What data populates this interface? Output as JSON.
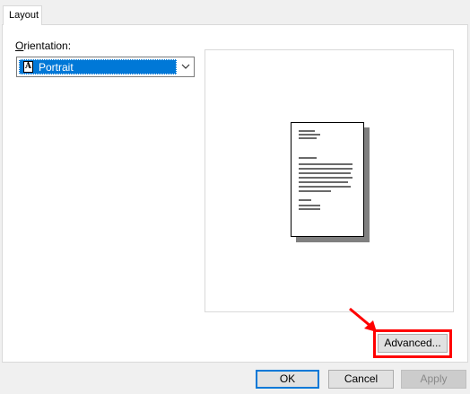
{
  "tabs": [
    {
      "label": "Layout",
      "active": true
    }
  ],
  "orientation": {
    "label_prefix": "O",
    "label_rest": "rientation:",
    "selected_value": "Portrait",
    "icon_letter": "A"
  },
  "buttons": {
    "advanced": "Advanced...",
    "ok": "OK",
    "cancel": "Cancel",
    "apply": "Apply"
  },
  "colors": {
    "selection": "#0078d7",
    "highlight": "#ff0000",
    "panel_bg": "#ffffff",
    "window_bg": "#f0f0f0"
  },
  "icons": {
    "dropdown": "chevron-down-icon",
    "orientation": "portrait-page-icon",
    "annotation": "red-arrow-icon"
  }
}
